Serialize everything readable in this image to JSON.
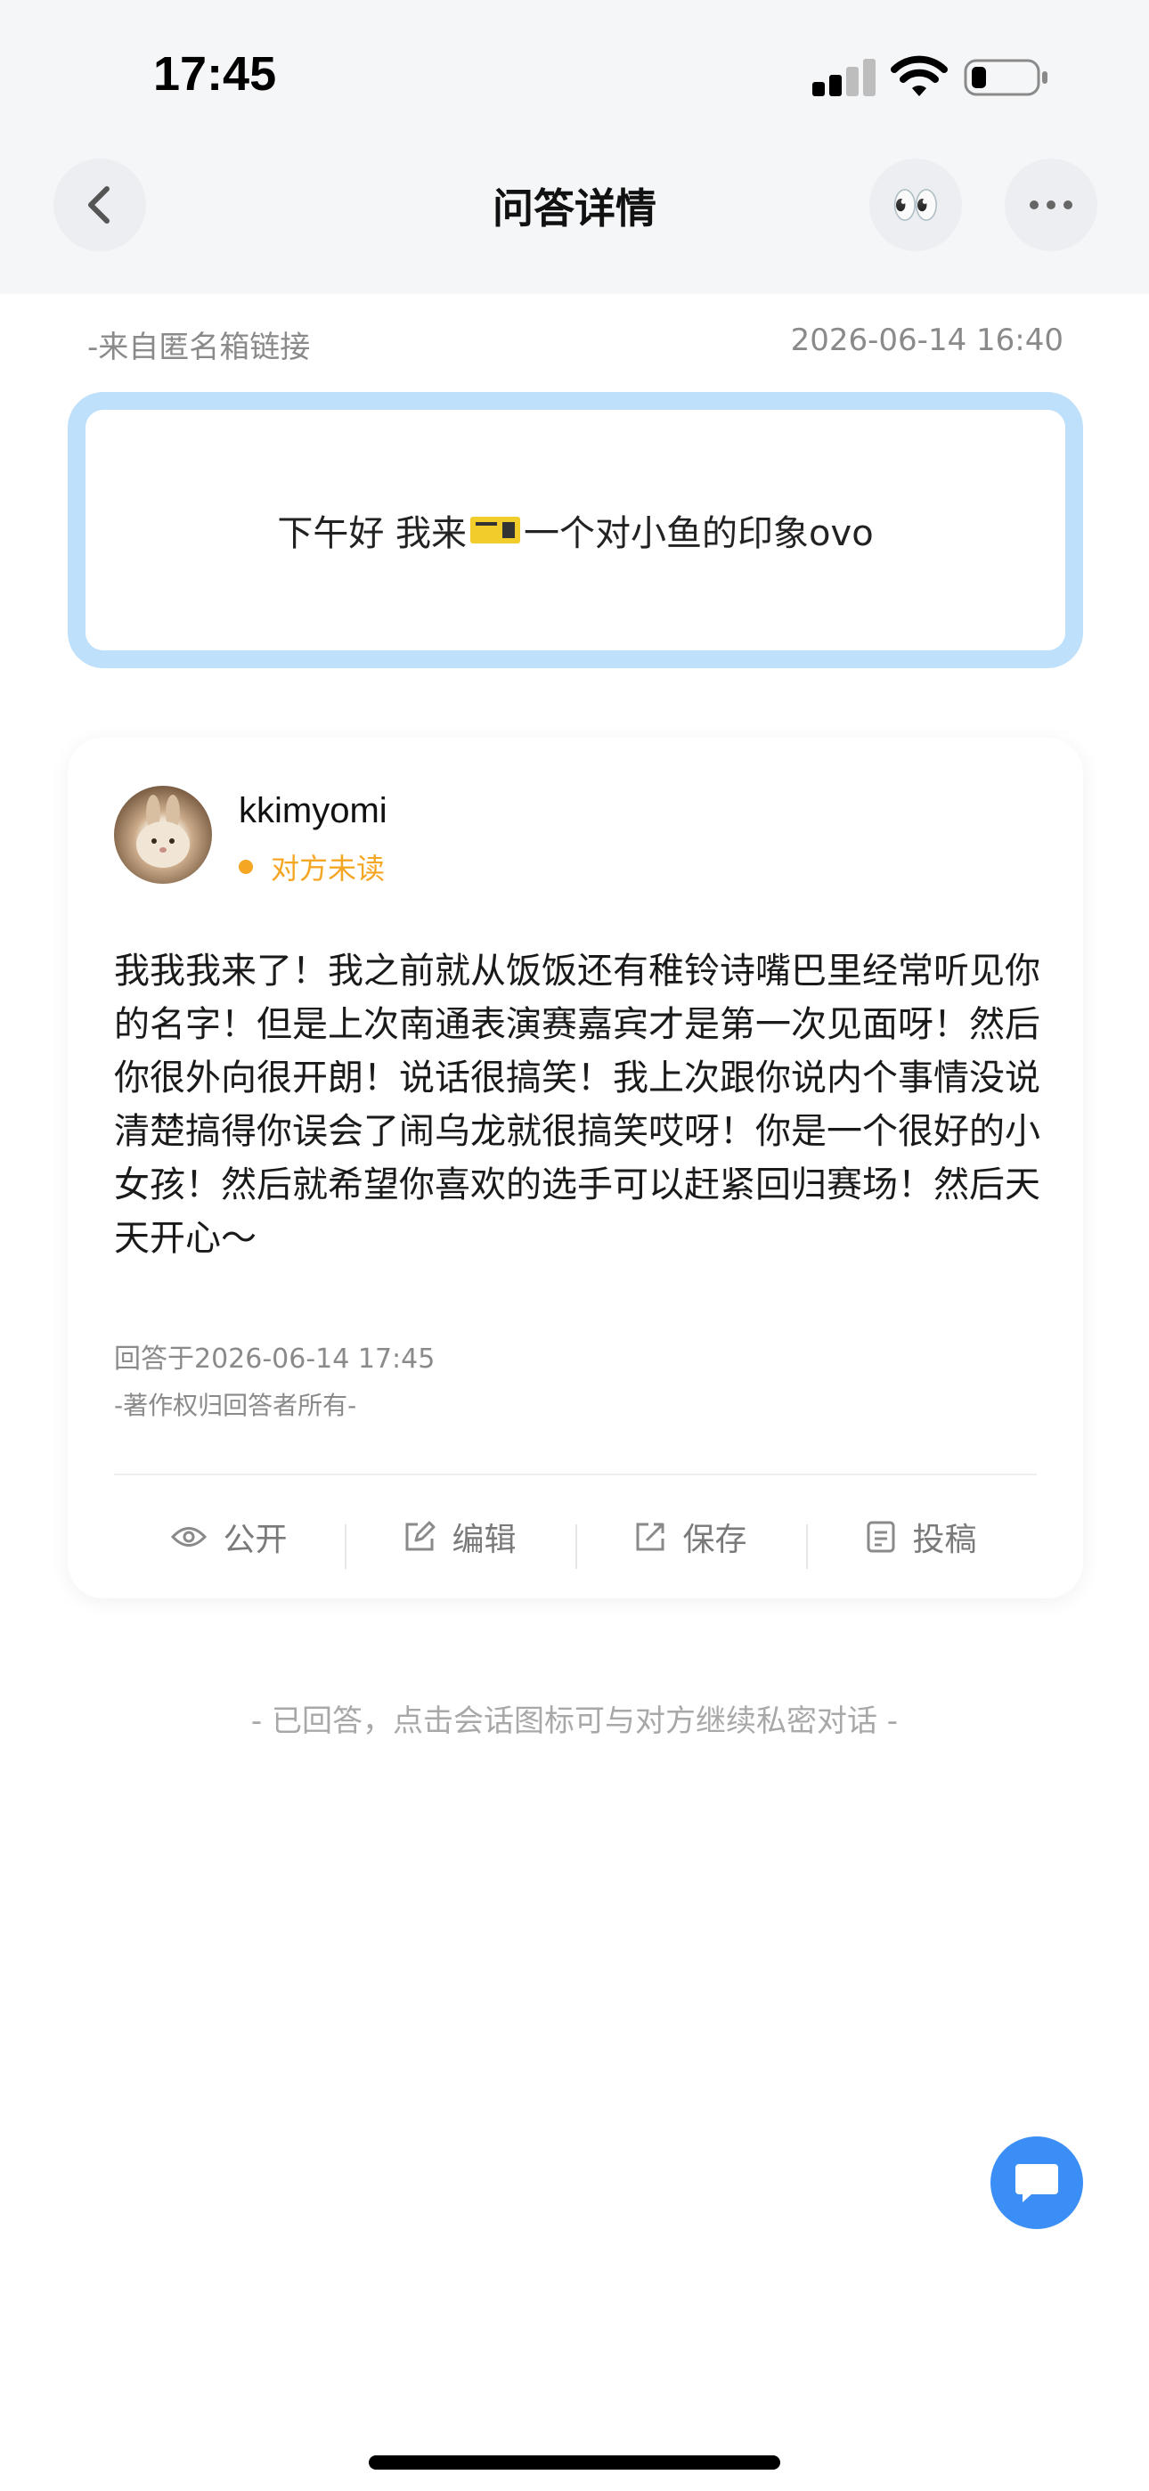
{
  "status_bar": {
    "time": "17:45"
  },
  "nav": {
    "title": "问答详情",
    "eyes_emoji": "👀"
  },
  "question": {
    "source": "-来自匿名箱链接",
    "time": "2026-06-14 16:40",
    "text_before": "下午好 我来",
    "text_after": "一个对小鱼的印象ovo"
  },
  "answer": {
    "username": "kkimyomi",
    "status": "对方未读",
    "text": "我我我来了！我之前就从饭饭还有稚铃诗嘴巴里经常听见你的名字！但是上次南通表演赛嘉宾才是第一次见面呀！然后你很外向很开朗！说话很搞笑！我上次跟你说内个事情没说清楚搞得你误会了闹乌龙就很搞笑哎呀！你是一个很好的小女孩！然后就希望你喜欢的选手可以赶紧回归赛场！然后天天开心～",
    "answered_at": "回答于2026-06-14 17:45",
    "copyright": "-著作权归回答者所有-",
    "actions": [
      {
        "label": "公开",
        "icon": "eye-icon"
      },
      {
        "label": "编辑",
        "icon": "edit-icon"
      },
      {
        "label": "保存",
        "icon": "share-icon"
      },
      {
        "label": "投稿",
        "icon": "document-icon"
      }
    ]
  },
  "hint": "- 已回答，点击会话图标可与对方继续私密对话 -",
  "colors": {
    "accent_blue": "#3a8ef6",
    "question_border": "#bfe0fb",
    "unread_orange": "#f5a623"
  }
}
